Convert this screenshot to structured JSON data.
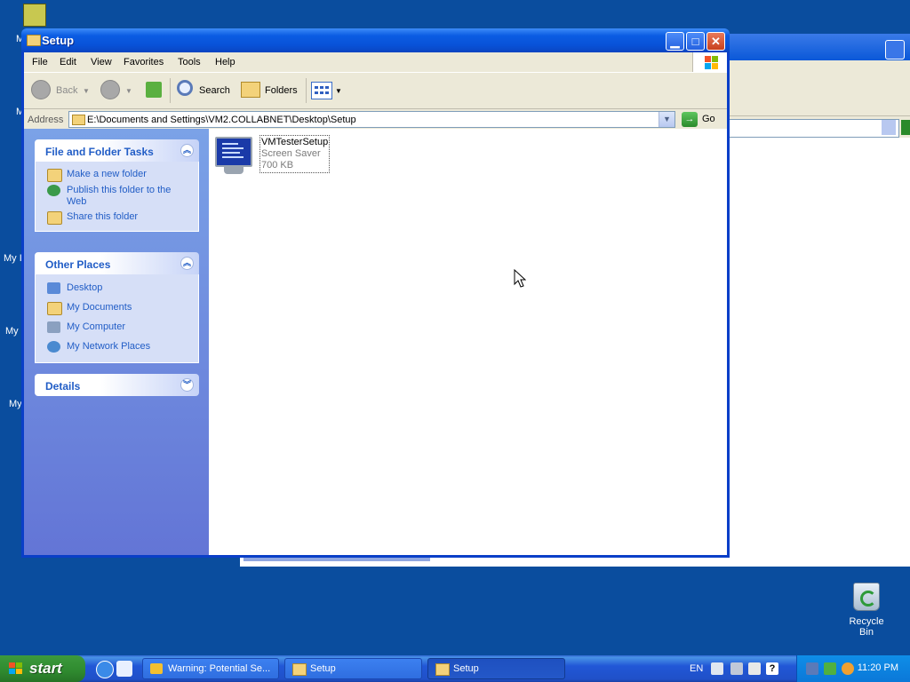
{
  "window": {
    "title": "Setup",
    "menu": [
      "File",
      "Edit",
      "View",
      "Favorites",
      "Tools",
      "Help"
    ],
    "toolbar": {
      "back": "Back",
      "search": "Search",
      "folders": "Folders"
    },
    "address": {
      "label": "Address",
      "path": "E:\\Documents and Settings\\VM2.COLLABNET\\Desktop\\Setup",
      "go": "Go"
    }
  },
  "taskpane": {
    "file_tasks": {
      "title": "File and Folder Tasks",
      "items": [
        "Make a new folder",
        "Publish this folder to the Web",
        "Share this folder"
      ]
    },
    "other_places": {
      "title": "Other Places",
      "items": [
        "Desktop",
        "My Documents",
        "My Computer",
        "My Network Places"
      ]
    },
    "details": {
      "title": "Details"
    }
  },
  "file": {
    "name": "VMTesterSetup",
    "type": "Screen Saver",
    "size": "700 KB"
  },
  "desktop": {
    "recycle_bin": "Recycle Bin",
    "fragments": [
      "M",
      "M",
      "My I",
      "My",
      "My"
    ]
  },
  "taskbar": {
    "start": "start",
    "buttons": [
      "Warning: Potential Se...",
      "Setup",
      "Setup"
    ],
    "lang": "EN",
    "clock": "11:20 PM"
  },
  "colors": {
    "xp_blue": "#0a4d9e",
    "titlebar": "#0852d8",
    "start_green": "#2f8a2f",
    "taskpane_link": "#215dc6"
  }
}
